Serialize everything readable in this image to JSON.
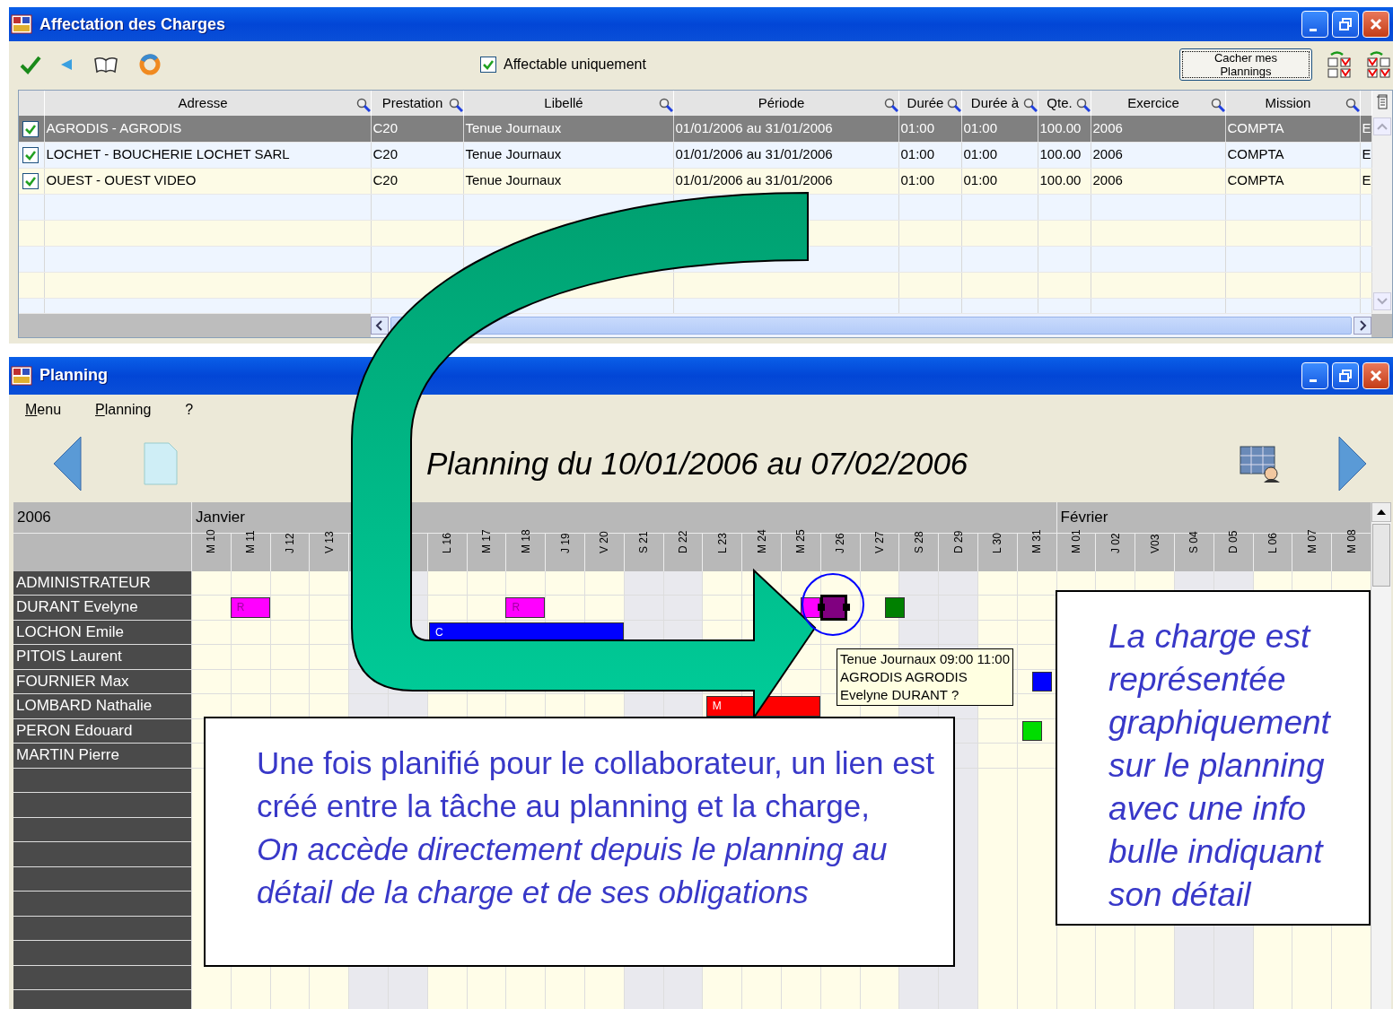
{
  "charges_window": {
    "title": "Affectation des Charges",
    "filter": {
      "label": "Affectable uniquement",
      "checked": true
    },
    "hide_button": "Cacher mes Plannings",
    "table": {
      "columns": [
        {
          "label": "Adresse"
        },
        {
          "label": "Prestation"
        },
        {
          "label": "Libellé"
        },
        {
          "label": "Période"
        },
        {
          "label": "Durée"
        },
        {
          "label": "Durée à"
        },
        {
          "label": "Qte."
        },
        {
          "label": "Exercice"
        },
        {
          "label": "Mission"
        },
        {}
      ],
      "rows": [
        {
          "checked": true,
          "selected": true,
          "cells": [
            "AGRODIS - AGRODIS",
            "C20",
            "Tenue Journaux",
            "01/01/2006 au 31/01/2006",
            "01:00",
            "01:00",
            "100.00",
            "2006",
            "COMPTA",
            "E"
          ]
        },
        {
          "checked": true,
          "selected": false,
          "cells": [
            "LOCHET - BOUCHERIE LOCHET SARL",
            "C20",
            "Tenue Journaux",
            "01/01/2006 au 31/01/2006",
            "01:00",
            "01:00",
            "100.00",
            "2006",
            "COMPTA",
            "E"
          ]
        },
        {
          "checked": true,
          "selected": false,
          "cells": [
            "OUEST - OUEST VIDEO",
            "C20",
            "Tenue Journaux",
            "01/01/2006 au 31/01/2006",
            "01:00",
            "01:00",
            "100.00",
            "2006",
            "COMPTA",
            "E"
          ]
        }
      ]
    }
  },
  "planning_window": {
    "title": "Planning",
    "menu": [
      "Menu",
      "Planning",
      "?"
    ],
    "headline": "Planning du 10/01/2006 au 07/02/2006",
    "year": "2006",
    "months": [
      {
        "label": "Janvier",
        "days": [
          {
            "label": "M 10",
            "weekend": false
          },
          {
            "label": "M 11",
            "weekend": false
          },
          {
            "label": "J 12",
            "weekend": false
          },
          {
            "label": "V 13",
            "weekend": false
          },
          {
            "weekend": true
          },
          {
            "weekend": true
          },
          {
            "label": "L 16",
            "weekend": false
          },
          {
            "label": "M 17",
            "weekend": false
          },
          {
            "label": "M 18",
            "weekend": false
          },
          {
            "label": "J 19",
            "weekend": false
          },
          {
            "label": "V 20",
            "weekend": false
          },
          {
            "label": "S 21",
            "weekend": true
          },
          {
            "label": "D 22",
            "weekend": true
          },
          {
            "label": "L 23",
            "weekend": false
          },
          {
            "label": "M 24",
            "weekend": false
          },
          {
            "label": "M 25",
            "weekend": false
          },
          {
            "label": "J 26",
            "weekend": false
          },
          {
            "label": "V 27",
            "weekend": false
          },
          {
            "label": "S 28",
            "weekend": true
          },
          {
            "label": "D 29",
            "weekend": true
          },
          {
            "label": "L 30",
            "weekend": false
          },
          {
            "label": "M 31",
            "weekend": false
          }
        ]
      },
      {
        "label": "Février",
        "days": [
          {
            "label": "M 01",
            "weekend": false
          },
          {
            "label": "J 02",
            "weekend": false
          },
          {
            "label": "V03",
            "weekend": false
          },
          {
            "label": "S 04",
            "weekend": true
          },
          {
            "label": "D 05",
            "weekend": true
          },
          {
            "label": "L 06",
            "weekend": false
          },
          {
            "label": "M 07",
            "weekend": false
          },
          {
            "label": "M 08",
            "weekend": false
          }
        ]
      }
    ],
    "resources": [
      {
        "name": "ADMINISTRATEUR"
      },
      {
        "name": "DURANT Evelyne",
        "bookings": [
          {
            "label": "R",
            "color": "#ff00ff",
            "selected": false
          },
          {
            "label": "R",
            "color": "#ff00ff",
            "selected": false
          },
          {
            "color": "#ff00ff",
            "selected": false
          },
          {
            "color": "#800080",
            "selected": true
          },
          {
            "color": "#008000",
            "selected": false
          }
        ]
      },
      {
        "name": "LOCHON Emile",
        "bookings": [
          {
            "label": "C",
            "color": "#0000ff",
            "selected": false
          }
        ]
      },
      {
        "name": "PITOIS Laurent"
      },
      {
        "name": "FOURNIER Max",
        "bookings": [
          {
            "color": "#0000ff",
            "selected": false
          }
        ]
      },
      {
        "name": "LOMBARD Nathalie",
        "bookings": [
          {
            "label": "M",
            "color": "#ff0000",
            "selected": false
          }
        ]
      },
      {
        "name": "PERON Edouard",
        "bookings": [
          {
            "color": "#00dd00",
            "selected": false
          }
        ]
      },
      {
        "name": "MARTIN Pierre"
      }
    ],
    "tooltip": [
      "Tenue Journaux 09:00 11:00",
      "AGRODIS AGRODIS",
      "Evelyne DURANT ?"
    ]
  },
  "callouts": [
    {
      "paragraphs": [
        {
          "text": "Une fois planifié pour le collaborateur, un lien est créé entre la tâche au planning et la charge,",
          "italic": false
        },
        {
          "text": "On accède directement depuis le planning au détail de la charge et de ses obligations",
          "italic": true
        }
      ]
    },
    {
      "paragraphs": [
        {
          "text": "La charge est représentée graphiquement sur le planning avec une info bulle indiquant son détail",
          "italic": true
        }
      ]
    }
  ]
}
